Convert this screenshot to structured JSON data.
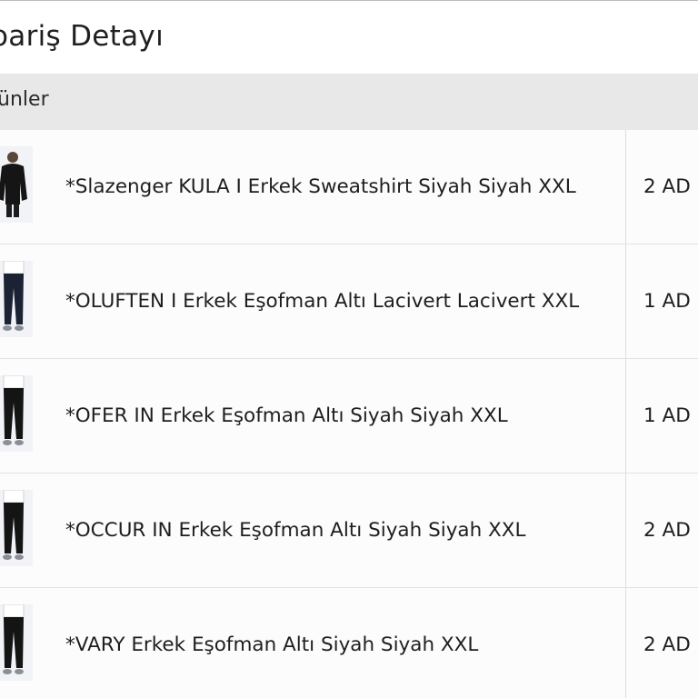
{
  "header": {
    "title": "oariş Detayı"
  },
  "section": {
    "title": "rünler"
  },
  "items": [
    {
      "name": "*Slazenger KULA I Erkek Sweatshirt Siyah Siyah XXL",
      "qty": "2 AD",
      "thumb": "sweatshirt-black"
    },
    {
      "name": "*OLUFTEN I Erkek Eşofman Altı Lacivert Lacivert XXL",
      "qty": "1 AD",
      "thumb": "pants-navy"
    },
    {
      "name": "*OFER IN Erkek Eşofman Altı Siyah Siyah XXL",
      "qty": "1 AD",
      "thumb": "pants-black"
    },
    {
      "name": "*OCCUR IN Erkek Eşofman Altı Siyah Siyah XXL",
      "qty": "2 AD",
      "thumb": "pants-black"
    },
    {
      "name": "*VARY Erkek Eşofman Altı Siyah Siyah XXL",
      "qty": "2 AD",
      "thumb": "pants-black"
    }
  ],
  "colors": {
    "section_bar": "#e8e8e8",
    "row_background": "#fcfcfc",
    "text": "#1e1e1e"
  }
}
